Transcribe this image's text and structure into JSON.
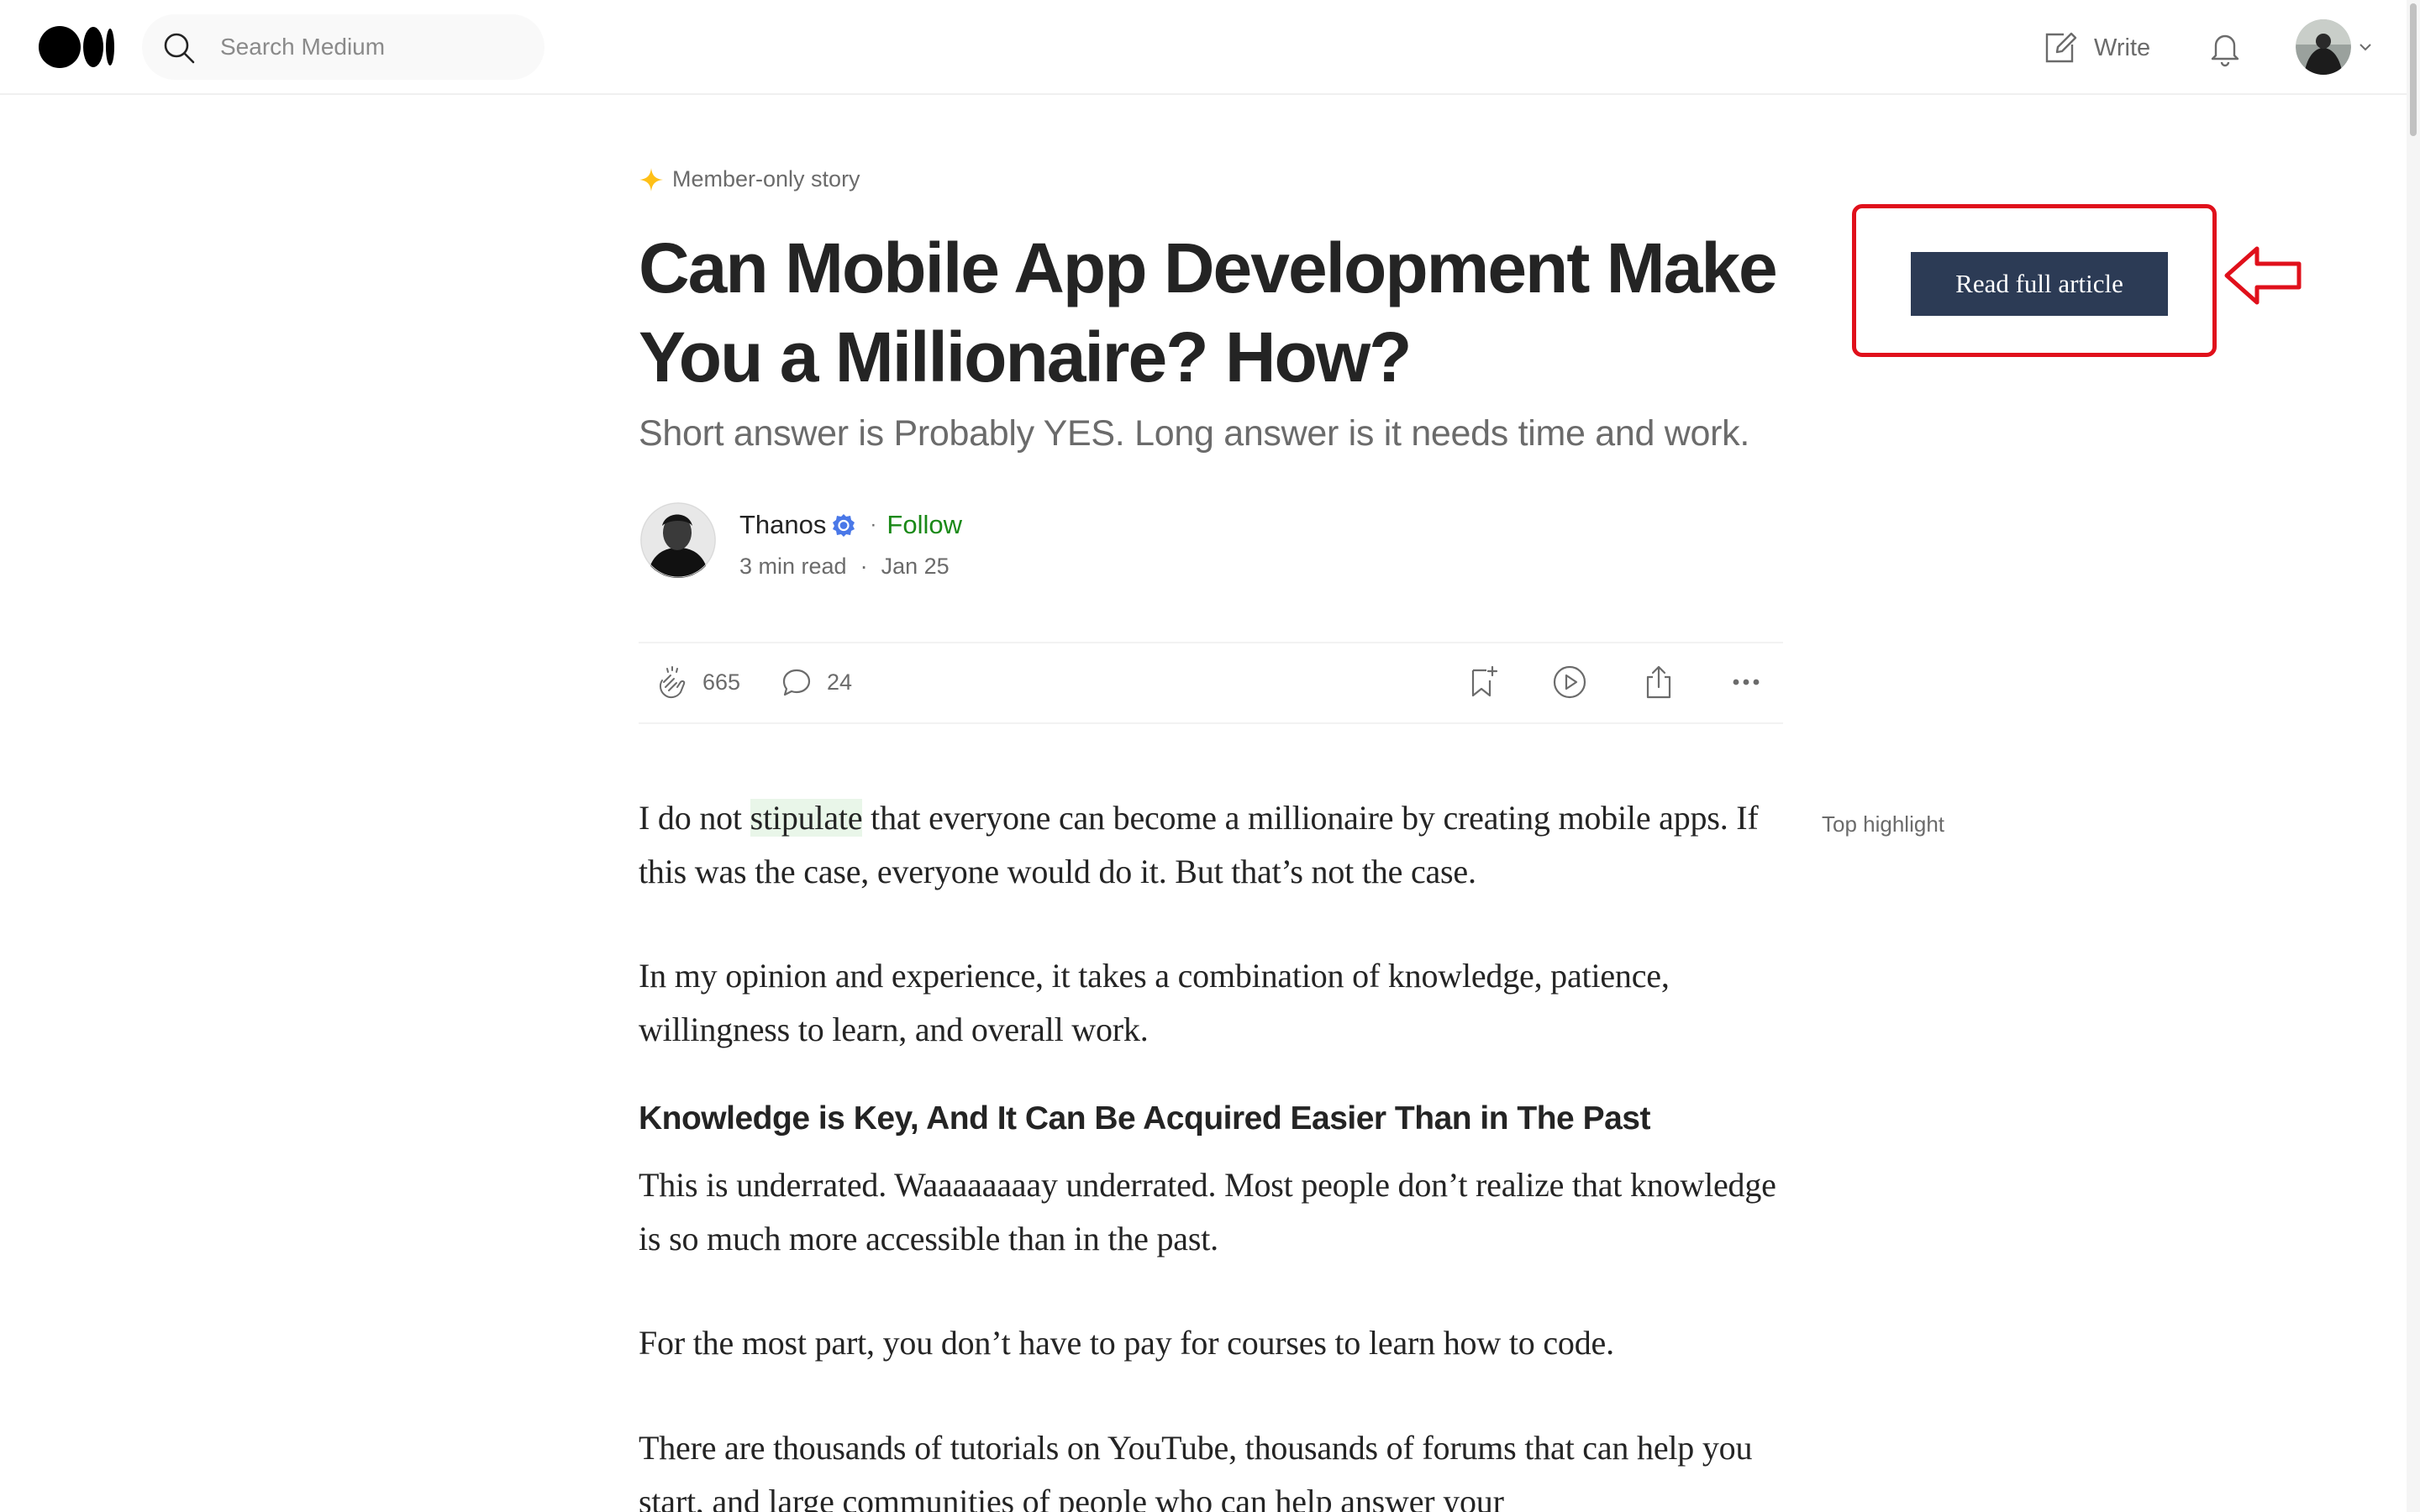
{
  "header": {
    "search_placeholder": "Search Medium",
    "write_label": "Write"
  },
  "article": {
    "member_label": "Member-only story",
    "title": "Can Mobile App Development Make You a Millionaire? How?",
    "subtitle": "Short answer is Probably YES. Long answer is it needs time and work.",
    "author": {
      "name": "Thanos",
      "follow_label": "Follow",
      "separator": "·",
      "read_time": "3 min read",
      "date": "Jan 25"
    },
    "actions": {
      "claps": "665",
      "responses": "24"
    },
    "paragraphs": {
      "p1_before": "I do not ",
      "p1_highlight": "stipulate",
      "p1_after": " that everyone can become a millionaire by creating mobile apps. If this was the case, everyone would do it. But that’s not the case.",
      "p2": "In my opinion and experience, it takes a combination of knowledge, patience, willingness to learn, and overall work.",
      "heading": "Knowledge is Key, And It Can Be Acquired Easier Than in The Past",
      "p3": "This is underrated. Waaaaaaaay underrated. Most people don’t realize that knowledge is so much more accessible than in the past.",
      "p4": "For the most part, you don’t have to pay for courses to learn how to code.",
      "p5": "There are thousands of tutorials on YouTube, thousands of forums that can help you start, and large communities of people who can help answer your"
    },
    "top_highlight_label": "Top highlight"
  },
  "cta": {
    "label": "Read full article"
  },
  "colors": {
    "follow_green": "#1a8917",
    "cta_bg": "#2c3b55",
    "annotation_red": "#e0101b",
    "highlight_bg": "#e9f6e9",
    "verified_blue": "#4a78e8",
    "star_gold": "#ffc017"
  }
}
